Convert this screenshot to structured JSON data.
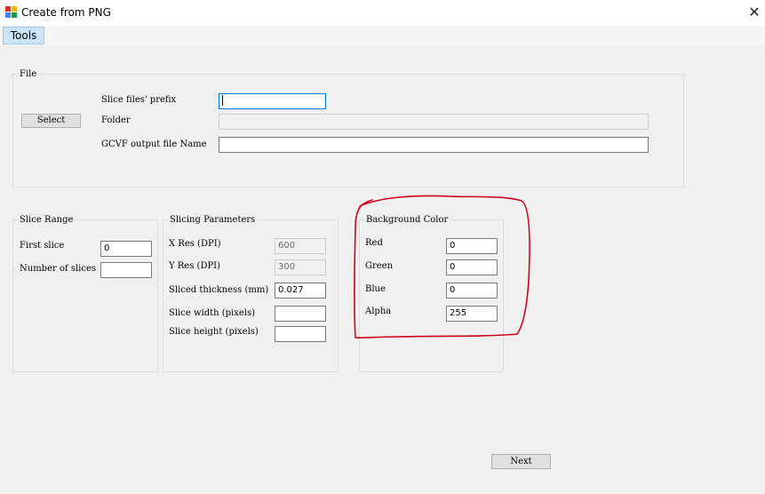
{
  "window": {
    "title": "Create from PNG",
    "close_symbol": "✕"
  },
  "menu": {
    "tools": "Tools"
  },
  "file_group": {
    "title": "File",
    "select_button": "Select",
    "prefix_label": "Slice files' prefix",
    "prefix_value": "",
    "folder_label": "Folder",
    "folder_value": "",
    "output_label": "GCVF output file Name",
    "output_value": ""
  },
  "slice_range": {
    "title": "Slice Range",
    "first_label": "First slice",
    "first_value": "0",
    "count_label": "Number of slices",
    "count_value": ""
  },
  "slicing_params": {
    "title": "Slicing Parameters",
    "xres_label": "X Res (DPI)",
    "xres_value": "600",
    "yres_label": "Y Res (DPI)",
    "yres_value": "300",
    "thickness_label": "Sliced thickness (mm)",
    "thickness_value": "0.027",
    "width_label": "Slice width (pixels)",
    "width_value": "",
    "height_label": "Slice height (pixels)",
    "height_value": ""
  },
  "background_color": {
    "title": "Background Color",
    "red_label": "Red",
    "red_value": "0",
    "green_label": "Green",
    "green_value": "0",
    "blue_label": "Blue",
    "blue_value": "0",
    "alpha_label": "Alpha",
    "alpha_value": "255"
  },
  "footer": {
    "next_button": "Next"
  },
  "colors": {
    "annotation": "#d0021b",
    "accent": "#0078d7",
    "menu_highlight": "#cce4f7"
  },
  "icons": {
    "app": "app-icon",
    "close": "close-icon"
  }
}
